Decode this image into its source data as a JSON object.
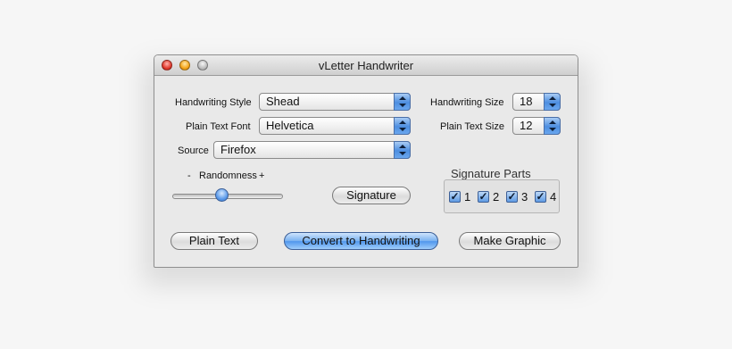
{
  "window": {
    "title": "vLetter Handwriter"
  },
  "labels": {
    "handwriting_style": "Handwriting Style",
    "plain_text_font": "Plain Text Font",
    "source": "Source",
    "handwriting_size": "Handwriting Size",
    "plain_text_size": "Plain Text Size",
    "randomness": "Randomness",
    "minus": "-",
    "plus": "+",
    "signature_parts": "Signature Parts"
  },
  "popups": {
    "handwriting_style": "Shead",
    "plain_text_font": "Helvetica",
    "source": "Firefox",
    "handwriting_size": "18",
    "plain_text_size": "12"
  },
  "buttons": {
    "signature": "Signature",
    "plain_text": "Plain Text",
    "convert": "Convert to Handwriting",
    "make_graphic": "Make Graphic"
  },
  "randomness_level": 0.45,
  "signature_parts": [
    {
      "label": "1",
      "checked": true
    },
    {
      "label": "2",
      "checked": true
    },
    {
      "label": "3",
      "checked": true
    },
    {
      "label": "4",
      "checked": true
    }
  ]
}
